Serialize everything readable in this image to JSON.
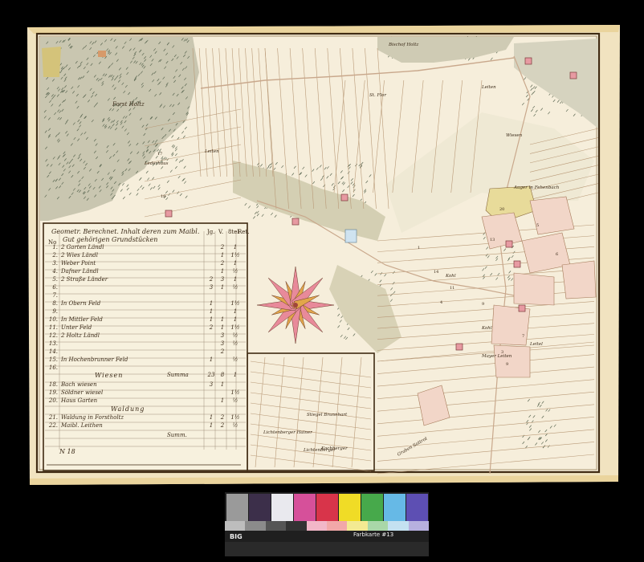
{
  "map": {
    "forest_label": "Forst Holtz",
    "labels": [
      {
        "text": "Bischof Holtz"
      },
      {
        "text": "Leiten"
      },
      {
        "text": "Wiesen"
      },
      {
        "text": "Auger in Fehenbach"
      },
      {
        "text": "St. Flor"
      },
      {
        "text": "Leiten"
      },
      {
        "text": "Lederhaus"
      },
      {
        "text": "Kohl"
      },
      {
        "text": "Mayer Leiten"
      },
      {
        "text": "Leitel"
      },
      {
        "text": "Kohl"
      },
      {
        "text": "Stiegel Brunnhart"
      },
      {
        "text": "Lichtenberger Hainer"
      },
      {
        "text": "Lichtenberger"
      },
      {
        "text": "Kochberger"
      },
      {
        "text": "Graben Sattrot"
      }
    ],
    "parcel_numbers": [
      "17",
      "18",
      "20",
      "14",
      "9",
      "11",
      "6",
      "5",
      "13",
      "7",
      "3",
      "1",
      "4",
      "9"
    ]
  },
  "legend": {
    "title_line1": "Geometr. Berechnet. Inhalt deren zum Maibl.",
    "title_line2": "Gut gehörigen Grundstücken",
    "col_no": "No",
    "col_j": "Jg.",
    "col_v": "V.",
    "col_q": "8tel",
    "col_r": "Ret.",
    "rows": [
      {
        "no": "1.",
        "name": "2 Garten Ländl",
        "j": "",
        "v": "2",
        "q": "1"
      },
      {
        "no": "2.",
        "name": "2 Wies Ländl",
        "j": "",
        "v": "1",
        "q": "1½"
      },
      {
        "no": "3.",
        "name": "Weber Point",
        "j": "",
        "v": "2",
        "q": "1"
      },
      {
        "no": "4.",
        "name": "Dafner Ländl",
        "j": "",
        "v": "1",
        "q": "½"
      },
      {
        "no": "5.",
        "name": "2 Straße Länder",
        "j": "2",
        "v": "3",
        "q": "1"
      },
      {
        "no": "6.",
        "name": "",
        "j": "3",
        "v": "1",
        "q": "½"
      },
      {
        "no": "7.",
        "name": "",
        "j": "",
        "v": "",
        "q": ""
      },
      {
        "no": "8.",
        "name": "In Obern Feld",
        "j": "1",
        "v": "",
        "q": "1½"
      },
      {
        "no": "9.",
        "name": "",
        "j": "1",
        "v": "",
        "q": "1"
      },
      {
        "no": "10.",
        "name": "In Mittler Feld",
        "j": "1",
        "v": "1",
        "q": "1"
      },
      {
        "no": "11.",
        "name": "Unter Feld",
        "j": "2",
        "v": "1",
        "q": "1½"
      },
      {
        "no": "12.",
        "name": "2 Holtz Ländl",
        "j": "",
        "v": "3",
        "q": "½"
      },
      {
        "no": "13.",
        "name": "",
        "j": "",
        "v": "3",
        "q": "½"
      },
      {
        "no": "14.",
        "name": "",
        "j": "",
        "v": "2",
        "q": ""
      },
      {
        "no": "15.",
        "name": "In Hochenbrunner Feld",
        "j": "1",
        "v": "",
        "q": "½"
      },
      {
        "no": "16.",
        "name": "",
        "j": "",
        "v": "",
        "q": ""
      }
    ],
    "summa_label": "Summa",
    "summa": {
      "j": "23",
      "v": "8",
      "q": "1"
    },
    "wiesen_label": "Wiesen",
    "wiesen_rows": [
      {
        "no": "18.",
        "name": "Bach wiesen",
        "j": "3",
        "v": "1",
        "q": ""
      },
      {
        "no": "19.",
        "name": "Söldner wiesel",
        "j": "",
        "v": "",
        "q": "1½"
      },
      {
        "no": "20.",
        "name": "Haus Garten",
        "j": "",
        "v": "1",
        "q": "½"
      }
    ],
    "waldung_label": "Waldung",
    "waldung_rows": [
      {
        "no": "21.",
        "name": "Waldung in Forstholtz",
        "j": "1",
        "v": "2",
        "q": "1½"
      },
      {
        "no": "22.",
        "name": "Maibl. Leithen",
        "j": "1",
        "v": "2",
        "q": "½"
      }
    ],
    "total_label": "Summ.",
    "signature": "N 18"
  },
  "color_card": {
    "brand": "Farbkarte #13",
    "big": "BIG",
    "swatches": [
      {
        "color": "#9a9a9a",
        "label": ""
      },
      {
        "color": "#3c2f4a",
        "label": "Dark Violet"
      },
      {
        "color": "#e9e9ee",
        "label": "White"
      },
      {
        "color": "#d6509a",
        "label": "Magenta"
      },
      {
        "color": "#d8344a",
        "label": "Red"
      },
      {
        "color": "#f0dc26",
        "label": "Yellow"
      },
      {
        "color": "#47a94b",
        "label": "Green"
      },
      {
        "color": "#66b9e6",
        "label": "Cyan"
      },
      {
        "color": "#5d4fb3",
        "label": "Blue"
      }
    ],
    "grays": [
      "#bdbdbd",
      "#8b8b8b",
      "#555555",
      "#333333",
      "#f2b7c8",
      "#f2a8a8",
      "#f3ea92",
      "#a9d7a8",
      "#c4e1f1",
      "#b7b0df"
    ]
  },
  "colors": {
    "parchment": "#f4ecd6",
    "border": "#4a3418",
    "frame": "#e9d39a",
    "forest": "#6f7e6a",
    "meadow_yellow": "#e9dc9a",
    "pink": "#e7a8a8",
    "compass_pink": "#e88a9a",
    "compass_gold": "#e2a64a"
  }
}
